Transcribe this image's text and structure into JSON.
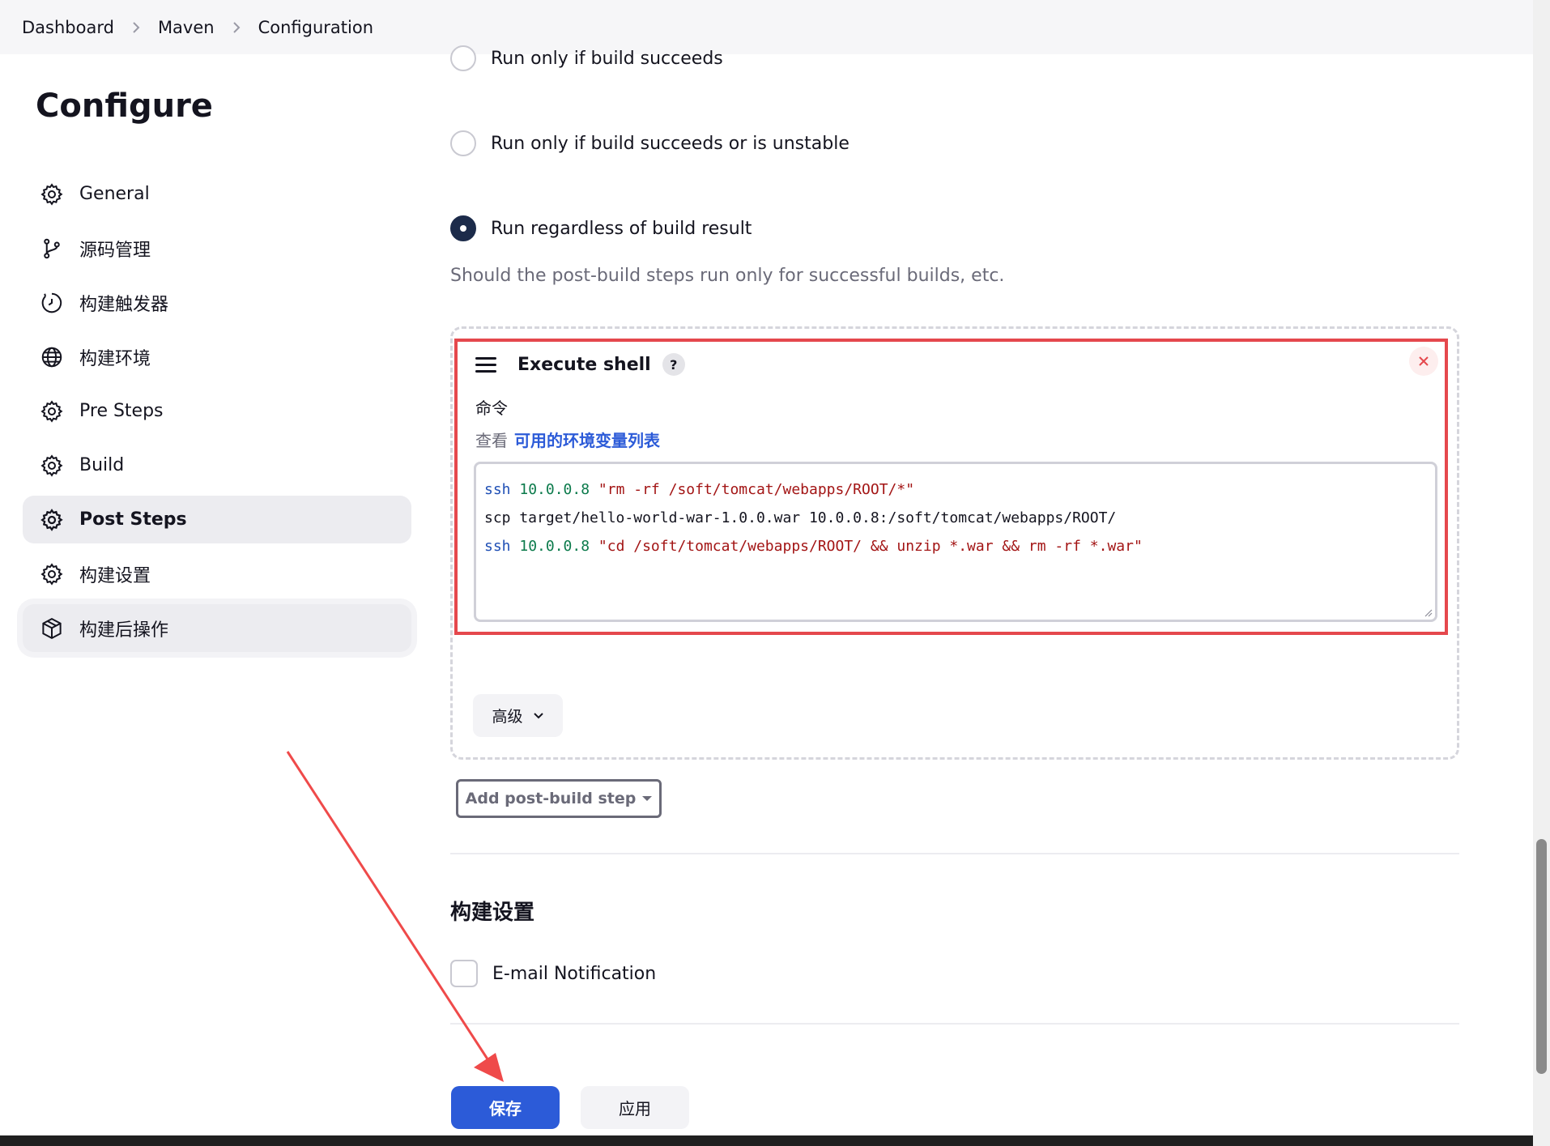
{
  "breadcrumb": {
    "items": [
      "Dashboard",
      "Maven",
      "Configuration"
    ]
  },
  "sidebar": {
    "title": "Configure",
    "items": [
      {
        "label": "General",
        "icon": "gear-icon"
      },
      {
        "label": "源码管理",
        "icon": "branch-icon"
      },
      {
        "label": "构建触发器",
        "icon": "timer-icon"
      },
      {
        "label": "构建环境",
        "icon": "globe-icon"
      },
      {
        "label": "Pre Steps",
        "icon": "gear-icon"
      },
      {
        "label": "Build",
        "icon": "gear-icon"
      },
      {
        "label": "Post Steps",
        "icon": "gear-icon",
        "active": true
      },
      {
        "label": "构建设置",
        "icon": "gear-icon"
      },
      {
        "label": "构建后操作",
        "icon": "package-icon",
        "hovered": true
      }
    ]
  },
  "post_steps": {
    "radios": [
      {
        "label": "Run only if build succeeds",
        "checked": false
      },
      {
        "label": "Run only if build succeeds or is unstable",
        "checked": false
      },
      {
        "label": "Run regardless of build result",
        "checked": true
      }
    ],
    "help": "Should the post-build steps run only for successful builds, etc.",
    "step": {
      "title": "Execute shell",
      "help_label": "?",
      "command_label": "命令",
      "env_prefix": "查看",
      "env_link": "可用的环境变量列表",
      "code_lines": [
        "ssh 10.0.0.8 \"rm -rf /soft/tomcat/webapps/ROOT/*\"",
        "scp target/hello-world-war-1.0.0.war 10.0.0.8:/soft/tomcat/webapps/ROOT/",
        "ssh 10.0.0.8 \"cd /soft/tomcat/webapps/ROOT/ && unzip *.war && rm -rf *.war\""
      ],
      "advanced_label": "高级"
    },
    "add_step_label": "Add post-build step"
  },
  "build_settings": {
    "title": "构建设置",
    "email_label": "E-mail Notification",
    "email_checked": false
  },
  "actions": {
    "save_label": "保存",
    "apply_label": "应用"
  },
  "colors": {
    "primary": "#2c5bd8",
    "highlight_border": "#e5484d",
    "annotation_arrow": "#ef4a4a",
    "radio_checked": "#1c2b4a"
  }
}
